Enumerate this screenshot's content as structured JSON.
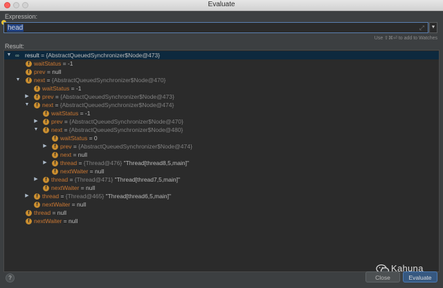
{
  "window": {
    "title": "Evaluate"
  },
  "expression": {
    "label": "Expression:",
    "value": "head",
    "hint": "Use ⇧⌘⏎ to add to Watches"
  },
  "result": {
    "label": "Result:",
    "rows": [
      {
        "name": "result",
        "value": "{AbstractQueuedSynchronizer$Node@473}",
        "ref": ""
      },
      {
        "name": "waitStatus",
        "value": "-1",
        "ref": ""
      },
      {
        "name": "prev",
        "value": "null",
        "ref": ""
      },
      {
        "name": "next",
        "value": "",
        "ref": "{AbstractQueuedSynchronizer$Node@470}"
      },
      {
        "name": "waitStatus",
        "value": "-1",
        "ref": ""
      },
      {
        "name": "prev",
        "value": "",
        "ref": "{AbstractQueuedSynchronizer$Node@473}"
      },
      {
        "name": "next",
        "value": "",
        "ref": "{AbstractQueuedSynchronizer$Node@474}"
      },
      {
        "name": "waitStatus",
        "value": "-1",
        "ref": ""
      },
      {
        "name": "prev",
        "value": "",
        "ref": "{AbstractQueuedSynchronizer$Node@470}"
      },
      {
        "name": "next",
        "value": "",
        "ref": "{AbstractQueuedSynchronizer$Node@480}"
      },
      {
        "name": "waitStatus",
        "value": "0",
        "ref": ""
      },
      {
        "name": "prev",
        "value": "",
        "ref": "{AbstractQueuedSynchronizer$Node@474}"
      },
      {
        "name": "next",
        "value": "null",
        "ref": ""
      },
      {
        "name": "thread",
        "value": "\"Thread[thread8,5,main]\"",
        "ref": "{Thread@476}"
      },
      {
        "name": "nextWaiter",
        "value": "null",
        "ref": ""
      },
      {
        "name": "thread",
        "value": "\"Thread[thread7,5,main]\"",
        "ref": "{Thread@471}"
      },
      {
        "name": "nextWaiter",
        "value": "null",
        "ref": ""
      },
      {
        "name": "thread",
        "value": "\"Thread[thread6,5,main]\"",
        "ref": "{Thread@465}"
      },
      {
        "name": "nextWaiter",
        "value": "null",
        "ref": ""
      },
      {
        "name": "thread",
        "value": "null",
        "ref": ""
      },
      {
        "name": "nextWaiter",
        "value": "null",
        "ref": ""
      }
    ]
  },
  "buttons": {
    "close": "Close",
    "evaluate": "Evaluate",
    "help": "?"
  },
  "watermark": {
    "text": "Kahuna"
  },
  "colors": {
    "field_icon": "#c98d2f",
    "selection": "#0d293e",
    "accent": "#365880"
  }
}
